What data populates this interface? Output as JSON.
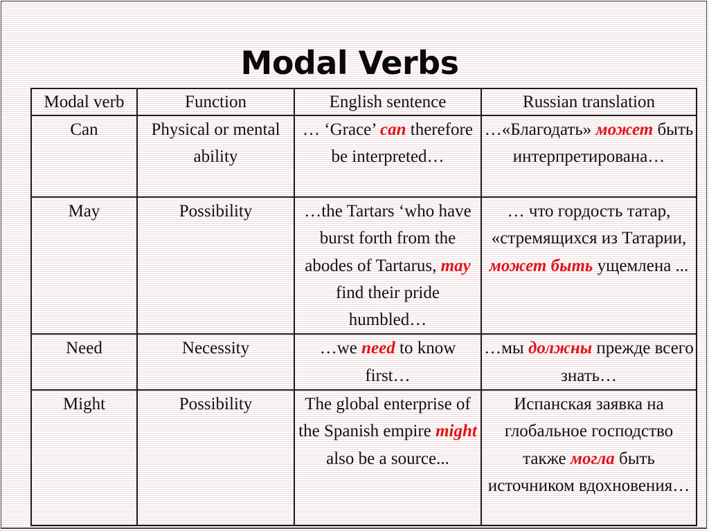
{
  "title": "Modal Verbs",
  "colors": {
    "highlight": "#e0141b",
    "text": "#111111",
    "border": "#1a1a1a",
    "background_lines": "#ead6d8"
  },
  "table": {
    "headers": [
      "Modal verb",
      "Function",
      "English sentence",
      "Russian translation"
    ],
    "rows": [
      {
        "modal_verb": "Can",
        "function": "Physical or mental ability",
        "english": {
          "before": "… ‘Grace’ ",
          "highlight": "can",
          "after": " therefore be interpreted…"
        },
        "russian": {
          "before": "…«Благодать» ",
          "highlight": "может",
          "after": " быть интерпретирована…"
        }
      },
      {
        "modal_verb": "May",
        "function": "Possibility",
        "english": {
          "before": "…the Tartars ‘who have burst forth from the abodes of Tartarus, ",
          "highlight": "may",
          "after": " find their pride humbled…"
        },
        "russian": {
          "before": "… что гордость татар, «стремящихся из Татарии, ",
          "highlight": "может быть",
          "after": " ущемлена ..."
        }
      },
      {
        "modal_verb": "Need",
        "function": "Necessity",
        "english": {
          "before": "…we ",
          "highlight": "need",
          "after": " to know first…"
        },
        "russian": {
          "before": "…мы ",
          "highlight": "должны",
          "after": " прежде всего знать…"
        }
      },
      {
        "modal_verb": "Might",
        "function": "Possibility",
        "english": {
          "before": "The global enterprise of the Spanish empire ",
          "highlight": "might",
          "after": " also be a source..."
        },
        "russian": {
          "before": "Испанская заявка на глобальное господство также ",
          "highlight": "могла",
          "after": " быть источником вдохновения…"
        }
      }
    ]
  }
}
